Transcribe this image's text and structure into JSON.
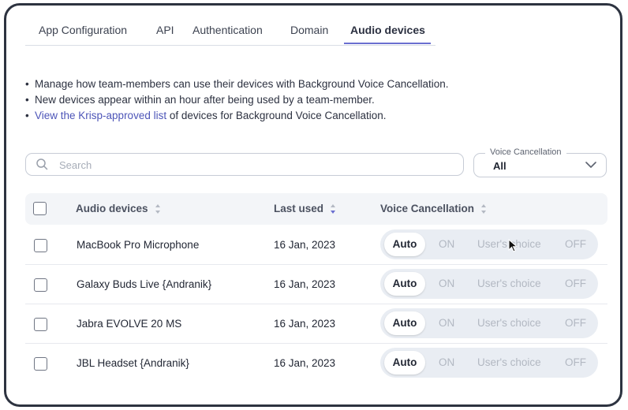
{
  "tabs": [
    {
      "label": "App Configuration",
      "active": false
    },
    {
      "label": "API",
      "active": false
    },
    {
      "label": "Authentication",
      "active": false
    },
    {
      "label": "Domain",
      "active": false
    },
    {
      "label": "Audio devices",
      "active": true
    }
  ],
  "bullets": {
    "line1": "Manage how team-members can use their devices with Background Voice Cancellation.",
    "line2": "New devices appear within an hour after being used by a team-member.",
    "line3_link": "View the Krisp-approved list",
    "line3_rest": " of devices for Background Voice Cancellation."
  },
  "search": {
    "placeholder": "Search",
    "value": ""
  },
  "filter": {
    "label": "Voice Cancellation",
    "value": "All"
  },
  "table": {
    "columns": [
      "Audio devices",
      "Last used",
      "Voice Cancellation"
    ],
    "options": [
      "Auto",
      "ON",
      "User's choice",
      "OFF"
    ],
    "rows": [
      {
        "device": "MacBook Pro Microphone",
        "last_used": "16 Jan, 2023",
        "selected": "Auto"
      },
      {
        "device": "Galaxy Buds Live {Andranik}",
        "last_used": "16 Jan, 2023",
        "selected": "Auto"
      },
      {
        "device": "Jabra EVOLVE 20 MS",
        "last_used": "16 Jan, 2023",
        "selected": "Auto"
      },
      {
        "device": "JBL Headset {Andranik}",
        "last_used": "16 Jan, 2023",
        "selected": "Auto"
      }
    ]
  },
  "colors": {
    "accent": "#6a6fd0",
    "link": "#4d55b8",
    "border": "#c7ccd6",
    "segment_bg": "#e9edf3"
  }
}
